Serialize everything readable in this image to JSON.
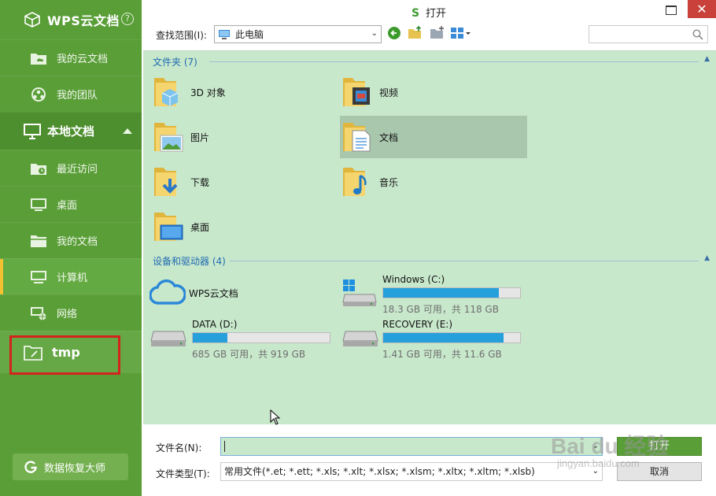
{
  "sidebar": {
    "brand": "WPS云文档",
    "help": "?",
    "cloud_items": [
      {
        "label": "我的云文档",
        "icon": "cloud-folder-icon"
      },
      {
        "label": "我的团队",
        "icon": "team-icon"
      }
    ],
    "local_group": {
      "label": "本地文档",
      "icon": "monitor-icon",
      "expanded": true
    },
    "local_items": [
      {
        "label": "最近访问",
        "icon": "recent-folder-icon"
      },
      {
        "label": "桌面",
        "icon": "desktop-icon"
      },
      {
        "label": "我的文档",
        "icon": "folder-icon"
      },
      {
        "label": "计算机",
        "icon": "computer-icon",
        "selected": true
      },
      {
        "label": "网络",
        "icon": "network-icon"
      }
    ],
    "tmp_item": {
      "label": "tmp",
      "icon": "folder-outline-icon"
    },
    "recover_button": "数据恢复大师"
  },
  "dialog": {
    "logo": "S",
    "title": "打开",
    "close_glyph": "✕",
    "lookin_label": "查找范围(I):",
    "lookin_value": "此电脑",
    "folders_header": "文件夹 (7)",
    "folders": [
      {
        "name": "3D 对象",
        "icon": "3d-objects-folder-icon"
      },
      {
        "name": "视频",
        "icon": "videos-folder-icon"
      },
      {
        "name": "图片",
        "icon": "pictures-folder-icon"
      },
      {
        "name": "文档",
        "icon": "documents-folder-icon",
        "selected": true
      },
      {
        "name": "下载",
        "icon": "downloads-folder-icon"
      },
      {
        "name": "音乐",
        "icon": "music-folder-icon"
      },
      {
        "name": "桌面",
        "icon": "desktop-folder-icon"
      }
    ],
    "drives_header": "设备和驱动器 (4)",
    "drives": [
      {
        "name": "WPS云文档",
        "icon": "wps-cloud-icon"
      },
      {
        "name": "Windows (C:)",
        "info": "18.3 GB 可用，共 118 GB",
        "used_fraction": 0.845,
        "icon": "windows-drive-icon"
      },
      {
        "name": "DATA (D:)",
        "info": "685 GB 可用，共 919 GB",
        "used_fraction": 0.255,
        "icon": "hard-drive-icon"
      },
      {
        "name": "RECOVERY (E:)",
        "info": "1.41 GB 可用，共 11.6 GB",
        "used_fraction": 0.878,
        "icon": "hard-drive-icon"
      }
    ],
    "filename_label": "文件名(N):",
    "filename_value": "",
    "filetype_label": "文件类型(T):",
    "filetype_value": "常用文件(*.et; *.ett; *.xls; *.xlt; *.xlsx; *.xlsm; *.xltx; *.xltm; *.xlsb)",
    "open_button": "打开",
    "cancel_button": "取消"
  },
  "watermark": {
    "main": "Bai du 经验",
    "sub": "jingyan.baidu.com"
  },
  "colors": {
    "sidebar": "#5a9e38",
    "content": "#c8e8cc",
    "accent_blue": "#1e6ab0",
    "drive_bar": "#26a0da",
    "highlight_box": "#d2231c"
  }
}
